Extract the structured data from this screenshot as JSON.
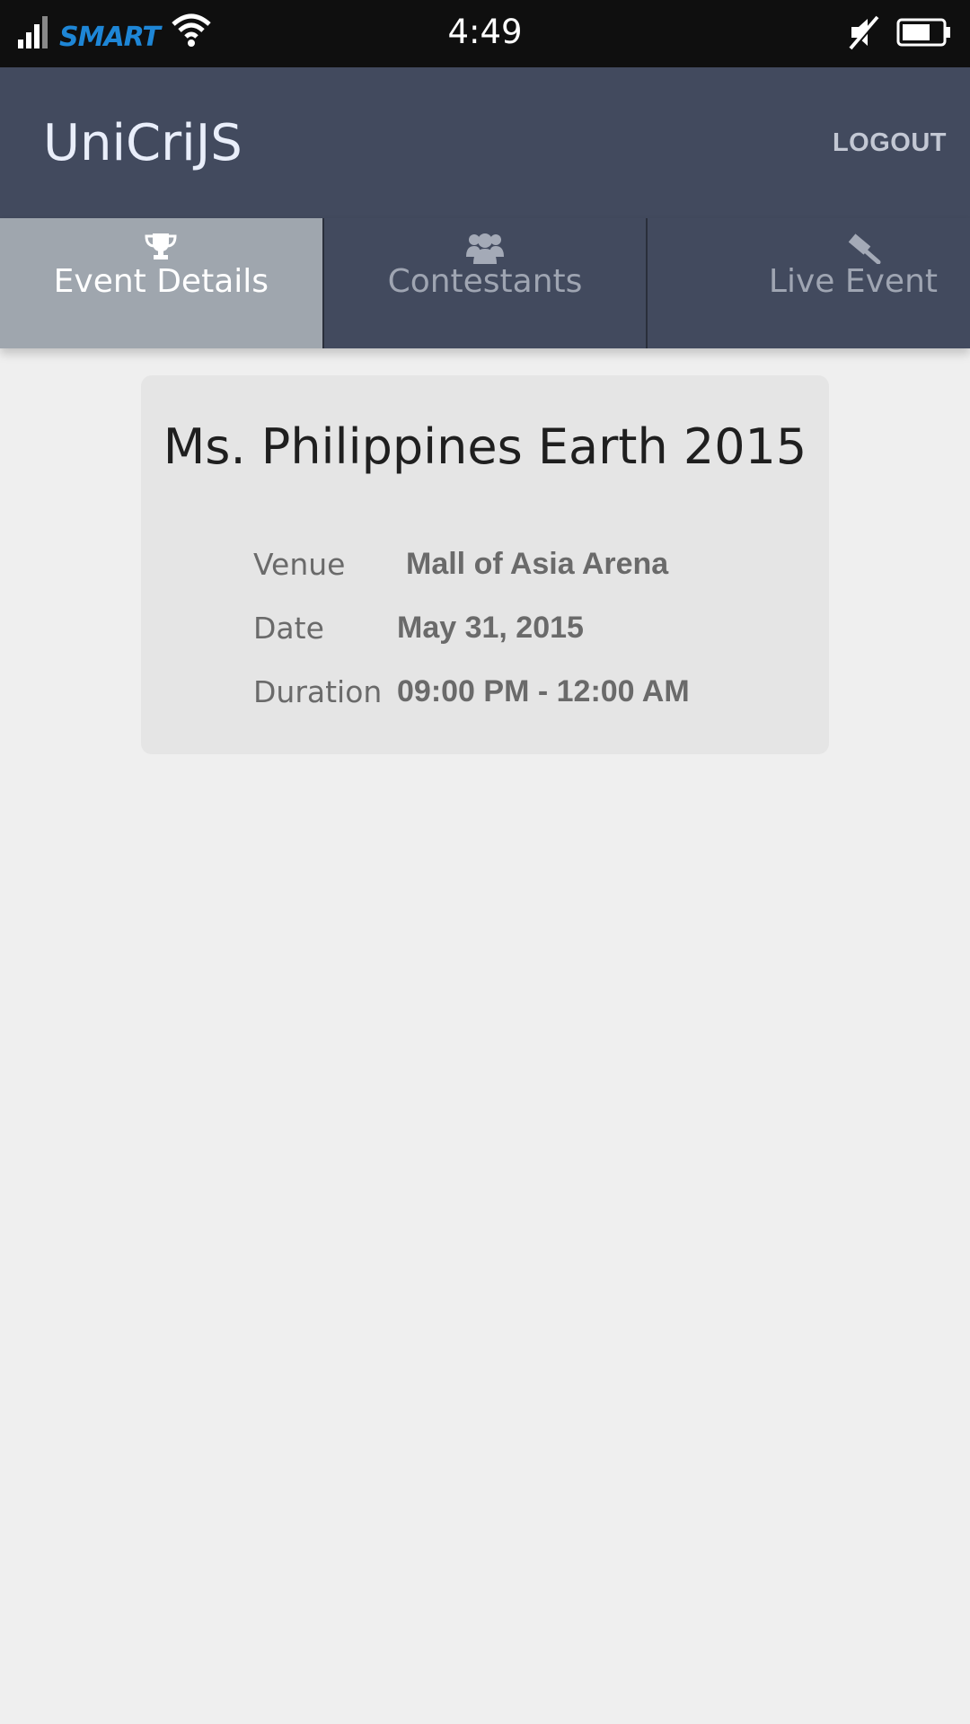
{
  "status_bar": {
    "carrier": "SMART",
    "time": "4:49",
    "icons": [
      "signal-icon",
      "wifi-icon",
      "mute-icon",
      "battery-icon"
    ]
  },
  "app_bar": {
    "title": "UniCriJS",
    "logout_label": "LOGOUT"
  },
  "tabs": [
    {
      "label": "Event Details",
      "icon": "trophy-icon",
      "active": true
    },
    {
      "label": "Contestants",
      "icon": "users-icon",
      "active": false
    },
    {
      "label": "Live Event",
      "icon": "gavel-icon",
      "active": false
    }
  ],
  "event": {
    "title": "Ms. Philippines Earth 2015",
    "details": [
      {
        "label": "Venue",
        "value": "Mall of Asia Arena"
      },
      {
        "label": "Date",
        "value": "May 31, 2015"
      },
      {
        "label": "Duration",
        "value": "09:00 PM - 12:00 AM"
      }
    ]
  },
  "colors": {
    "app_bar": "#424a5e",
    "active_tab": "#9fa6ae",
    "background": "#efefef",
    "card": "#e5e5e5",
    "carrier_brand": "#1e86d6"
  }
}
